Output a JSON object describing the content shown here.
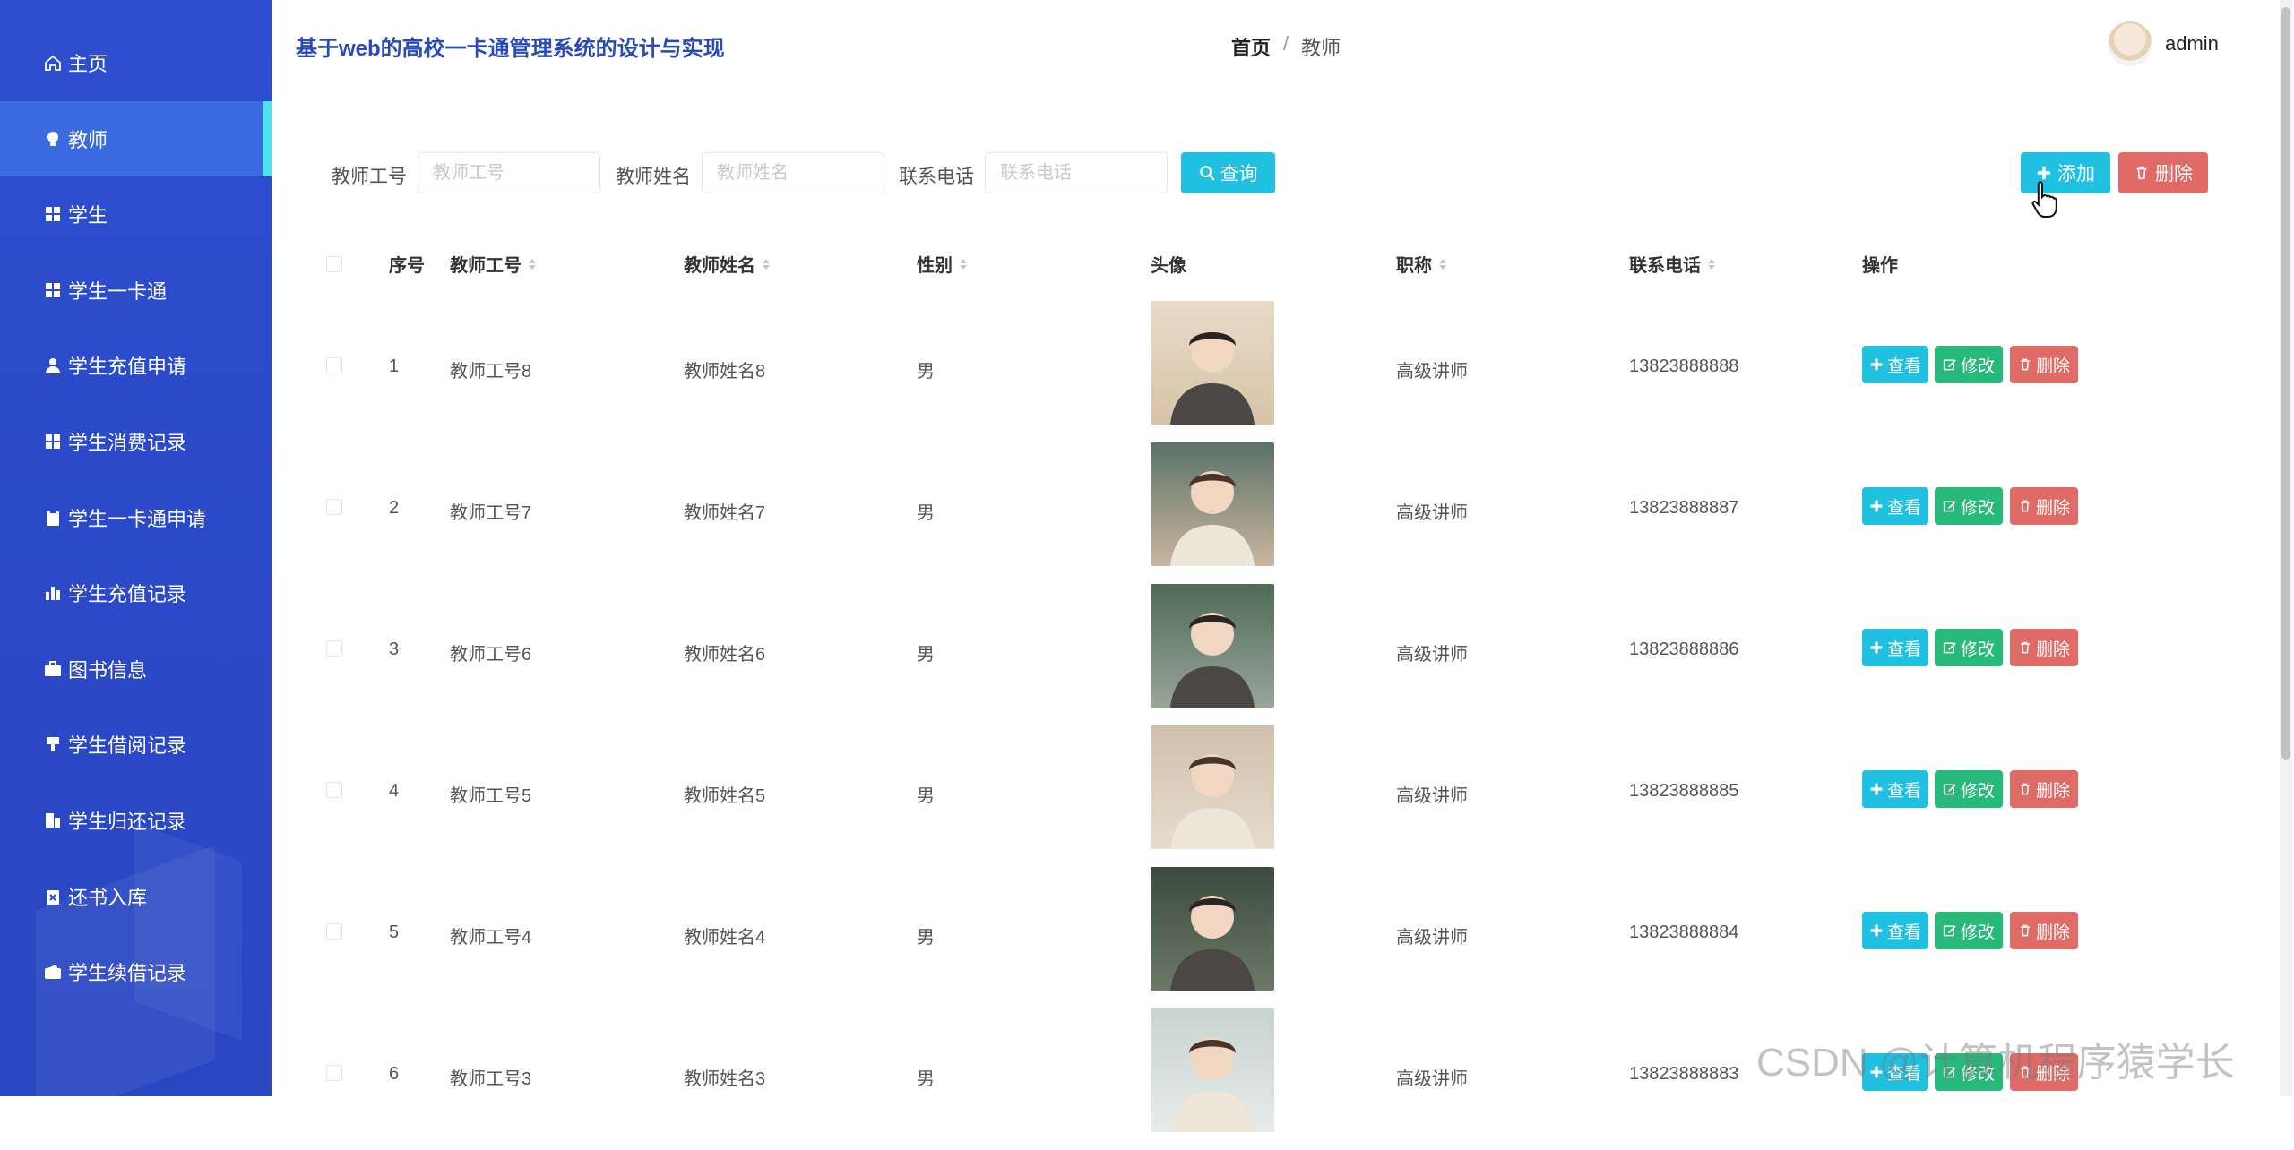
{
  "app": {
    "title": "基于web的高校一卡通管理系统的设计与实现"
  },
  "breadcrumb": {
    "home": "首页",
    "separator": "/",
    "current": "教师"
  },
  "user": {
    "name": "admin"
  },
  "sidebar": {
    "items": [
      {
        "label": "主页",
        "icon": "home-icon"
      },
      {
        "label": "教师",
        "icon": "bulb-icon",
        "active": true
      },
      {
        "label": "学生",
        "icon": "grid-icon"
      },
      {
        "label": "学生一卡通",
        "icon": "grid-icon"
      },
      {
        "label": "学生充值申请",
        "icon": "user-icon"
      },
      {
        "label": "学生消费记录",
        "icon": "grid-icon"
      },
      {
        "label": "学生一卡通申请",
        "icon": "clipboard-icon"
      },
      {
        "label": "学生充值记录",
        "icon": "bar-chart-icon"
      },
      {
        "label": "图书信息",
        "icon": "briefcase-icon"
      },
      {
        "label": "学生借阅记录",
        "icon": "brush-icon"
      },
      {
        "label": "学生归还记录",
        "icon": "building-icon"
      },
      {
        "label": "还书入库",
        "icon": "clipboard-x-icon"
      },
      {
        "label": "学生续借记录",
        "icon": "wallet-icon"
      }
    ]
  },
  "search": {
    "teacher_id_label": "教师工号",
    "teacher_id_placeholder": "教师工号",
    "teacher_name_label": "教师姓名",
    "teacher_name_placeholder": "教师姓名",
    "phone_label": "联系电话",
    "phone_placeholder": "联系电话",
    "query_button": "查询"
  },
  "actions": {
    "add": "添加",
    "delete": "删除"
  },
  "table": {
    "headers": {
      "index": "序号",
      "teacher_id": "教师工号",
      "teacher_name": "教师姓名",
      "gender": "性别",
      "avatar": "头像",
      "title": "职称",
      "phone": "联系电话",
      "actions": "操作"
    },
    "row_actions": {
      "view": "查看",
      "edit": "修改",
      "delete": "删除"
    },
    "rows": [
      {
        "index": "1",
        "teacher_id": "教师工号8",
        "teacher_name": "教师姓名8",
        "gender": "男",
        "title": "高级讲师",
        "phone": "13823888888"
      },
      {
        "index": "2",
        "teacher_id": "教师工号7",
        "teacher_name": "教师姓名7",
        "gender": "男",
        "title": "高级讲师",
        "phone": "13823888887"
      },
      {
        "index": "3",
        "teacher_id": "教师工号6",
        "teacher_name": "教师姓名6",
        "gender": "男",
        "title": "高级讲师",
        "phone": "13823888886"
      },
      {
        "index": "4",
        "teacher_id": "教师工号5",
        "teacher_name": "教师姓名5",
        "gender": "男",
        "title": "高级讲师",
        "phone": "13823888885"
      },
      {
        "index": "5",
        "teacher_id": "教师工号4",
        "teacher_name": "教师姓名4",
        "gender": "男",
        "title": "高级讲师",
        "phone": "13823888884"
      },
      {
        "index": "6",
        "teacher_id": "教师工号3",
        "teacher_name": "教师姓名3",
        "gender": "男",
        "title": "高级讲师",
        "phone": "13823888883"
      }
    ]
  },
  "watermark": "CSDN @计算机程序猿学长",
  "colors": {
    "sidebar": "#2d4fd0",
    "active": "#3a6be0",
    "accent": "#20c0e0",
    "edit": "#27b97a",
    "danger": "#e06a66"
  }
}
